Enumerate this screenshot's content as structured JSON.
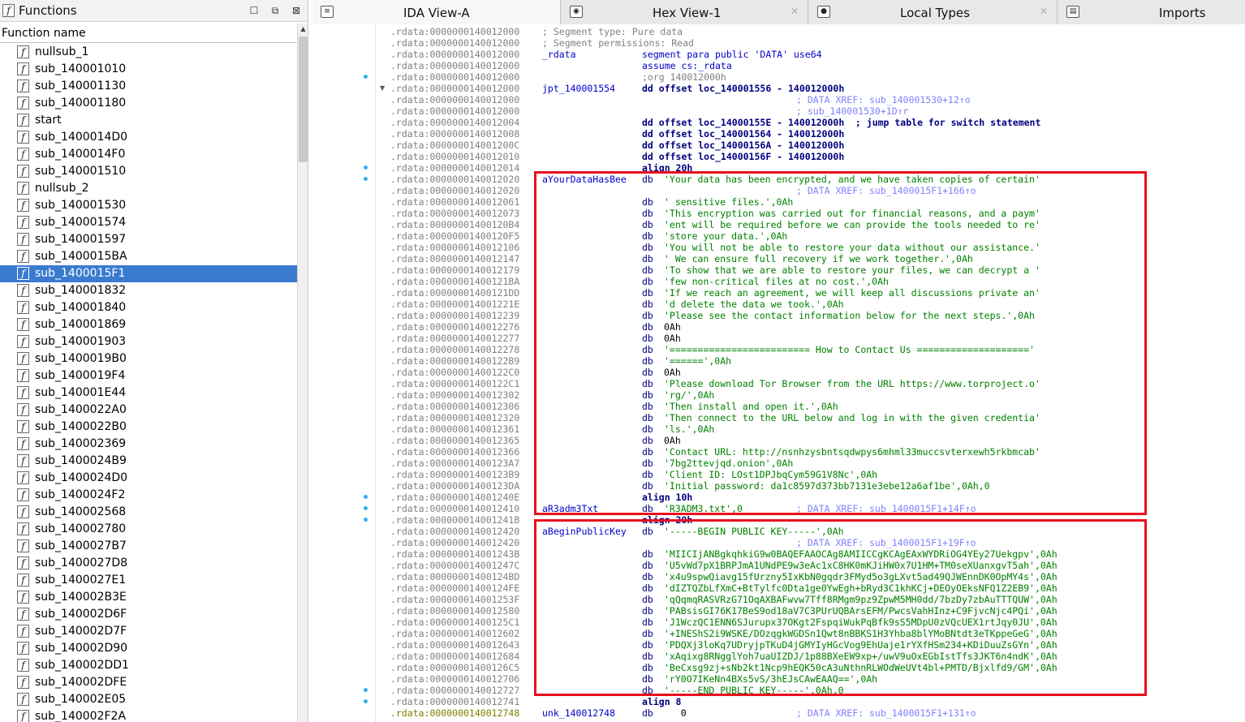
{
  "functions_panel": {
    "title": "Functions",
    "column_header": "Function name",
    "title_icon": "function-icon",
    "buttons": [
      "restore-icon",
      "maximize-icon",
      "close-icon"
    ],
    "selected_index": 13,
    "items": [
      "nullsub_1",
      "sub_140001010",
      "sub_140001130",
      "sub_140001180",
      "start",
      "sub_1400014D0",
      "sub_1400014F0",
      "sub_140001510",
      "nullsub_2",
      "sub_140001530",
      "sub_140001574",
      "sub_140001597",
      "sub_1400015BA",
      "sub_1400015F1",
      "sub_140001832",
      "sub_140001840",
      "sub_140001869",
      "sub_140001903",
      "sub_1400019B0",
      "sub_1400019F4",
      "sub_140001E44",
      "sub_1400022A0",
      "sub_1400022B0",
      "sub_140002369",
      "sub_1400024B9",
      "sub_1400024D0",
      "sub_1400024F2",
      "sub_140002568",
      "sub_140002780",
      "sub_1400027B7",
      "sub_1400027D8",
      "sub_1400027E1",
      "sub_140002B3E",
      "sub_140002D6F",
      "sub_140002D7F",
      "sub_140002D90",
      "sub_140002DD1",
      "sub_140002DFE",
      "sub_140002E05",
      "sub_140002F2A"
    ]
  },
  "tabs": [
    {
      "label": "IDA View-A",
      "icon": "disassembly-icon",
      "active": true,
      "closable": false
    },
    {
      "label": "Hex View-1",
      "icon": "hex-icon",
      "active": false,
      "closable": true
    },
    {
      "label": "Local Types",
      "icon": "types-icon",
      "active": false,
      "closable": true
    },
    {
      "label": "Imports",
      "icon": "imports-icon",
      "active": false,
      "closable": false
    }
  ],
  "colors": {
    "address": "#808080",
    "label": "#0000c8",
    "string": "#008000",
    "comment": "#8080ff",
    "highlight_box": "#e8101f",
    "selection": "#3a7bd0"
  },
  "disasm_lines": [
    {
      "addr": ".rdata:0000000140012000",
      "label": "",
      "mnem": "",
      "operand": "; Segment type: Pure data",
      "kind": "segcmt"
    },
    {
      "addr": ".rdata:0000000140012000",
      "label": "",
      "mnem": "",
      "operand": "; Segment permissions: Read",
      "kind": "segcmt"
    },
    {
      "addr": ".rdata:0000000140012000",
      "label": "_rdata",
      "mnem": "segment para public 'DATA' use64",
      "operand": "",
      "kind": "seg"
    },
    {
      "addr": ".rdata:0000000140012000",
      "label": "",
      "mnem": "assume cs:_rdata",
      "operand": "",
      "kind": "seg"
    },
    {
      "addr": ".rdata:0000000140012000",
      "label": "",
      "mnem": ";org 140012000h",
      "operand": "",
      "kind": "gray"
    },
    {
      "addr": ".rdata:0000000140012000",
      "label": "jpt_140001554",
      "mnem": "dd offset loc_140001556 - 140012000h",
      "operand": "",
      "kind": "code"
    },
    {
      "addr": ".rdata:0000000140012000",
      "label": "",
      "mnem": "",
      "operand": "; DATA XREF: sub_140001530+12↑o",
      "kind": "xref"
    },
    {
      "addr": ".rdata:0000000140012000",
      "label": "",
      "mnem": "",
      "operand": "; sub_140001530+1D↑r",
      "kind": "xref"
    },
    {
      "addr": ".rdata:0000000140012004",
      "label": "",
      "mnem": "dd offset loc_14000155E - 140012000h",
      "operand": " ; jump table for switch statement",
      "kind": "code"
    },
    {
      "addr": ".rdata:0000000140012008",
      "label": "",
      "mnem": "dd offset loc_140001564 - 140012000h",
      "operand": "",
      "kind": "code"
    },
    {
      "addr": ".rdata:000000014001200C",
      "label": "",
      "mnem": "dd offset loc_14000156A - 140012000h",
      "operand": "",
      "kind": "code"
    },
    {
      "addr": ".rdata:0000000140012010",
      "label": "",
      "mnem": "dd offset loc_14000156F - 140012000h",
      "operand": "",
      "kind": "code"
    },
    {
      "addr": ".rdata:0000000140012014",
      "label": "",
      "mnem": "align 20h",
      "operand": "",
      "kind": "code"
    },
    {
      "addr": ".rdata:0000000140012020",
      "label": "aYourDataHasBee",
      "mnem": "db",
      "operand": "'Your data has been encrypted, and we have taken copies of certain'",
      "kind": "str"
    },
    {
      "addr": ".rdata:0000000140012020",
      "label": "",
      "mnem": "",
      "operand": "; DATA XREF: sub_1400015F1+166↑o",
      "kind": "xref"
    },
    {
      "addr": ".rdata:0000000140012061",
      "label": "",
      "mnem": "db",
      "operand": "' sensitive files.',0Ah",
      "kind": "str"
    },
    {
      "addr": ".rdata:0000000140012073",
      "label": "",
      "mnem": "db",
      "operand": "'This encryption was carried out for financial reasons, and a paym'",
      "kind": "str"
    },
    {
      "addr": ".rdata:00000001400120B4",
      "label": "",
      "mnem": "db",
      "operand": "'ent will be required before we can provide the tools needed to re'",
      "kind": "str"
    },
    {
      "addr": ".rdata:00000001400120F5",
      "label": "",
      "mnem": "db",
      "operand": "'store your data.',0Ah",
      "kind": "str"
    },
    {
      "addr": ".rdata:0000000140012106",
      "label": "",
      "mnem": "db",
      "operand": "'You will not be able to restore your data without our assistance.'",
      "kind": "str"
    },
    {
      "addr": ".rdata:0000000140012147",
      "label": "",
      "mnem": "db",
      "operand": "' We can ensure full recovery if we work together.',0Ah",
      "kind": "str"
    },
    {
      "addr": ".rdata:0000000140012179",
      "label": "",
      "mnem": "db",
      "operand": "'To show that we are able to restore your files, we can decrypt a '",
      "kind": "str"
    },
    {
      "addr": ".rdata:00000001400121BA",
      "label": "",
      "mnem": "db",
      "operand": "'few non-critical files at no cost.',0Ah",
      "kind": "str"
    },
    {
      "addr": ".rdata:00000001400121DD",
      "label": "",
      "mnem": "db",
      "operand": "'If we reach an agreement, we will keep all discussions private an'",
      "kind": "str"
    },
    {
      "addr": ".rdata:000000014001221E",
      "label": "",
      "mnem": "db",
      "operand": "'d delete the data we took.',0Ah",
      "kind": "str"
    },
    {
      "addr": ".rdata:0000000140012239",
      "label": "",
      "mnem": "db",
      "operand": "'Please see the contact information below for the next steps.',0Ah",
      "kind": "str"
    },
    {
      "addr": ".rdata:0000000140012276",
      "label": "",
      "mnem": "db",
      "operand": "0Ah",
      "kind": "num"
    },
    {
      "addr": ".rdata:0000000140012277",
      "label": "",
      "mnem": "db",
      "operand": "0Ah",
      "kind": "num"
    },
    {
      "addr": ".rdata:0000000140012278",
      "label": "",
      "mnem": "db",
      "operand": "'========================= How to Contact Us ===================='",
      "kind": "str"
    },
    {
      "addr": ".rdata:00000001400122B9",
      "label": "",
      "mnem": "db",
      "operand": "'======',0Ah",
      "kind": "str"
    },
    {
      "addr": ".rdata:00000001400122C0",
      "label": "",
      "mnem": "db",
      "operand": "0Ah",
      "kind": "num"
    },
    {
      "addr": ".rdata:00000001400122C1",
      "label": "",
      "mnem": "db",
      "operand": "'Please download Tor Browser from the URL https://www.torproject.o'",
      "kind": "str"
    },
    {
      "addr": ".rdata:0000000140012302",
      "label": "",
      "mnem": "db",
      "operand": "'rg/',0Ah",
      "kind": "str"
    },
    {
      "addr": ".rdata:0000000140012306",
      "label": "",
      "mnem": "db",
      "operand": "'Then install and open it.',0Ah",
      "kind": "str"
    },
    {
      "addr": ".rdata:0000000140012320",
      "label": "",
      "mnem": "db",
      "operand": "'Then connect to the URL below and log in with the given credentia'",
      "kind": "str"
    },
    {
      "addr": ".rdata:0000000140012361",
      "label": "",
      "mnem": "db",
      "operand": "'ls.',0Ah",
      "kind": "str"
    },
    {
      "addr": ".rdata:0000000140012365",
      "label": "",
      "mnem": "db",
      "operand": "0Ah",
      "kind": "num"
    },
    {
      "addr": ".rdata:0000000140012366",
      "label": "",
      "mnem": "db",
      "operand": "'Contact URL: http://nsnhzysbntsqdwpys6mhml33muccsvterxewh5rkbmcab'",
      "kind": "str"
    },
    {
      "addr": ".rdata:00000001400123A7",
      "label": "",
      "mnem": "db",
      "operand": "'7bg2ttevjqd.onion',0Ah",
      "kind": "str"
    },
    {
      "addr": ".rdata:00000001400123B9",
      "label": "",
      "mnem": "db",
      "operand": "'Client ID: LOst1DPJbqCym59G1V8Nc',0Ah",
      "kind": "str"
    },
    {
      "addr": ".rdata:00000001400123DA",
      "label": "",
      "mnem": "db",
      "operand": "'Initial password: da1c8597d373bb7131e3ebe12a6af1be',0Ah,0",
      "kind": "str"
    },
    {
      "addr": ".rdata:000000014001240E",
      "label": "",
      "mnem": "align 10h",
      "operand": "",
      "kind": "code"
    },
    {
      "addr": ".rdata:0000000140012410",
      "label": "aR3adm3Txt",
      "mnem": "db",
      "operand": "'R3ADM3.txt',0",
      "kind": "str",
      "xref": "; DATA XREF: sub_1400015F1+14F↑o"
    },
    {
      "addr": ".rdata:000000014001241B",
      "label": "",
      "mnem": "align 20h",
      "operand": "",
      "kind": "code"
    },
    {
      "addr": ".rdata:0000000140012420",
      "label": "aBeginPublicKey",
      "mnem": "db",
      "operand": "'-----BEGIN PUBLIC KEY-----',0Ah",
      "kind": "str"
    },
    {
      "addr": ".rdata:0000000140012420",
      "label": "",
      "mnem": "",
      "operand": "; DATA XREF: sub_1400015F1+19F↑o",
      "kind": "xref"
    },
    {
      "addr": ".rdata:000000014001243B",
      "label": "",
      "mnem": "db",
      "operand": "'MIICIjANBgkqhkiG9w0BAQEFAAOCAg8AMIICCgKCAgEAxWYDRiOG4YEy27Uekgpv',0Ah",
      "kind": "str"
    },
    {
      "addr": ".rdata:000000014001247C",
      "label": "",
      "mnem": "db",
      "operand": "'U5vWd7pX1BRPJmA1UNdPE9w3eAc1xC8HK0mKJiHW0x7U1HM+TM0seXUanxgvT5ah',0Ah",
      "kind": "str"
    },
    {
      "addr": ".rdata:00000001400124BD",
      "label": "",
      "mnem": "db",
      "operand": "'x4u9spwQiavg15fUrzny5IxKbN0gqdr3FMyd5o3gLXvt5ad49QJWEnnDK0OpMY4s',0Ah",
      "kind": "str"
    },
    {
      "addr": ".rdata:00000001400124FE",
      "label": "",
      "mnem": "db",
      "operand": "'dIZTQZbLfXmC+BtTylfc0Dta1ge0YwEgh+bRyd3C1khKCj+DEOyOEksNFQ1Z2EB9',0Ah",
      "kind": "str"
    },
    {
      "addr": ".rdata:000000014001253F",
      "label": "",
      "mnem": "db",
      "operand": "'qQqmqRASVRzG71OqAXBAFwvw7Tff8RMgm9pz9ZpwM5MH0dd/7bzDy7zbAuTTTQUW',0Ah",
      "kind": "str"
    },
    {
      "addr": ".rdata:0000000140012580",
      "label": "",
      "mnem": "db",
      "operand": "'PABsisGI76K17BeS9od18aV7C3PUrUQBArsEFM/PwcsVahHInz+C9FjvcNjc4PQi',0Ah",
      "kind": "str"
    },
    {
      "addr": ".rdata:00000001400125C1",
      "label": "",
      "mnem": "db",
      "operand": "'J1WczQC1ENN6SJurupx37OKgt2FspqiWukPqBfk9sS5MDpU0zVQcUEX1rtJqy0JU',0Ah",
      "kind": "str"
    },
    {
      "addr": ".rdata:0000000140012602",
      "label": "",
      "mnem": "db",
      "operand": "'+INEShS2i9WSKE/DOzqgkWGDSn1Qwt8nBBKS1H3Yhba8blYMoBNtdt3eTKppeGeG',0Ah",
      "kind": "str"
    },
    {
      "addr": ".rdata:0000000140012643",
      "label": "",
      "mnem": "db",
      "operand": "'PDQXj3loKq7UDryjpTKuD4jGMYIyHGcVog9EhUaje1rYXfHSm234+KDiDuuZsGYn',0Ah",
      "kind": "str"
    },
    {
      "addr": ".rdata:0000000140012684",
      "label": "",
      "mnem": "db",
      "operand": "'xAqixg8RNgglYoh7uaUIZDJ/1p88BXeEW9xp+/uwV9uOxEGbIstTfs3JKT6n4ndK',0Ah",
      "kind": "str"
    },
    {
      "addr": ".rdata:00000001400126C5",
      "label": "",
      "mnem": "db",
      "operand": "'BeCxsg9zj+sNb2kt1Ncp9hEQK50cA3uNthnRLWOdWeUVt4bl+PMTD/Bjxlfd9/GM',0Ah",
      "kind": "str"
    },
    {
      "addr": ".rdata:0000000140012706",
      "label": "",
      "mnem": "db",
      "operand": "'rY0O7IKeNn4BXs5vS/3hEJsCAwEAAQ==',0Ah",
      "kind": "str"
    },
    {
      "addr": ".rdata:0000000140012727",
      "label": "",
      "mnem": "db",
      "operand": "'-----END PUBLIC KEY-----',0Ah,0",
      "kind": "str"
    },
    {
      "addr": ".rdata:0000000140012741",
      "label": "",
      "mnem": "align 8",
      "operand": "",
      "kind": "code"
    },
    {
      "addr": ".rdata:0000000140012748",
      "label": "unk_140012748",
      "mnem": "db",
      "operand": "   0",
      "kind": "num",
      "xref": "; DATA XREF: sub_1400015F1+131↑o",
      "addr_hl": true
    }
  ]
}
